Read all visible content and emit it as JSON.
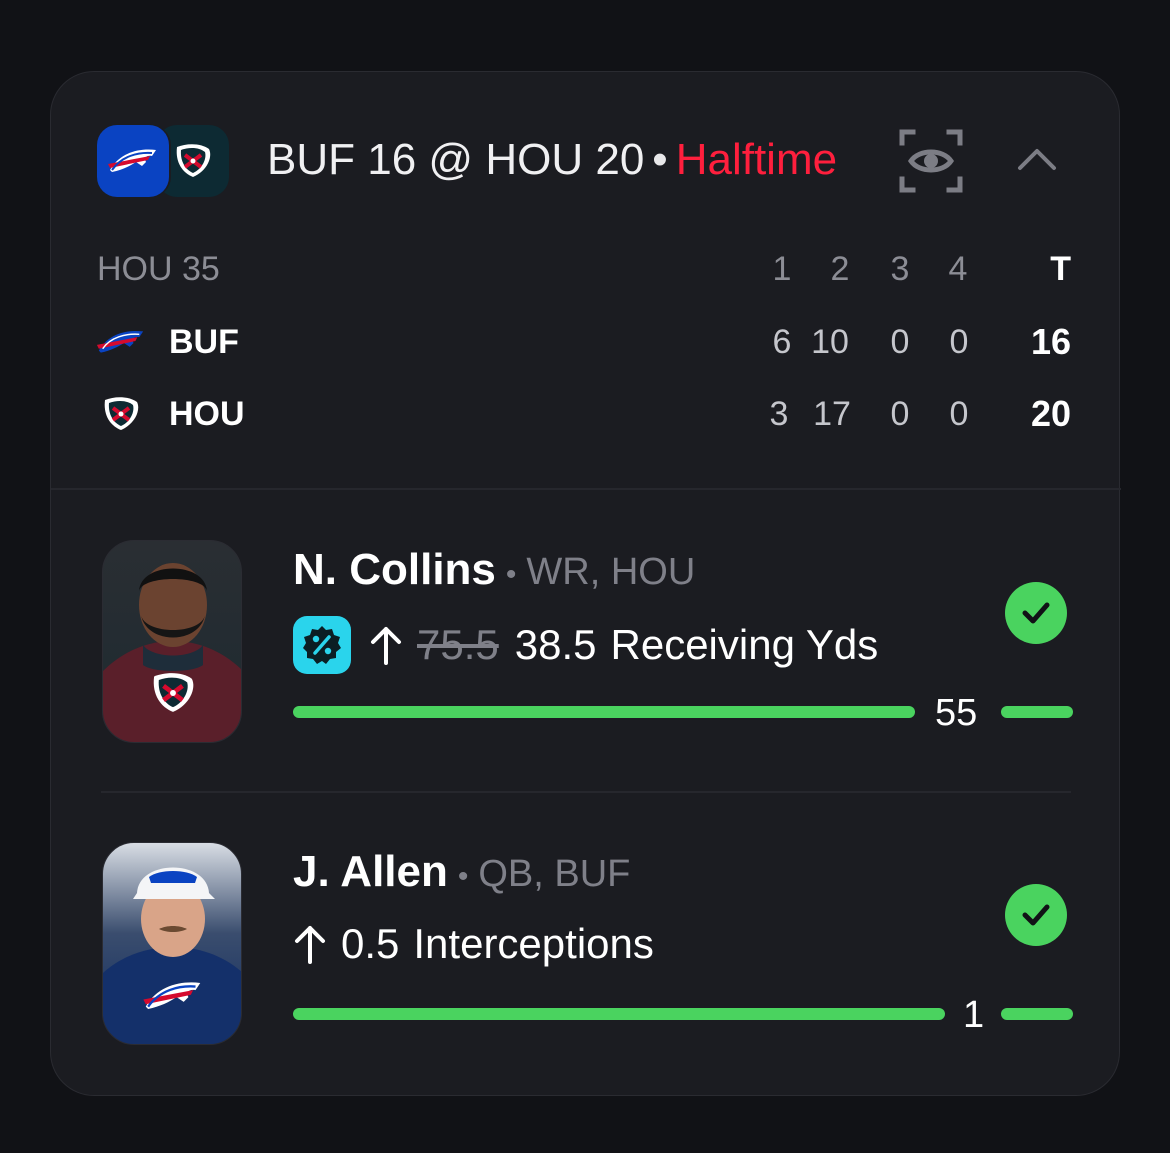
{
  "header": {
    "away_abbr": "BUF",
    "away_score": "16",
    "at": "@",
    "home_abbr": "HOU",
    "home_score": "20",
    "separator": "•",
    "status": "Halftime",
    "icons": [
      "bills-logo",
      "texans-logo",
      "eye-scan-icon",
      "chevron-up-icon"
    ],
    "status_color": "#ff1f3d"
  },
  "scoreboard": {
    "possession": "HOU 35",
    "quarter_headers": [
      "1",
      "2",
      "3",
      "4"
    ],
    "total_header": "T",
    "teams": [
      {
        "abbr": "BUF",
        "quarters": [
          "6",
          "10",
          "0",
          "0"
        ],
        "total": "16",
        "logo": "bills-logo"
      },
      {
        "abbr": "HOU",
        "quarters": [
          "3",
          "17",
          "0",
          "0"
        ],
        "total": "20",
        "logo": "texans-logo"
      }
    ]
  },
  "props": [
    {
      "player": "N. Collins",
      "separator": "•",
      "position_team": "WR, HOU",
      "boost_icon": "percent-boost-icon",
      "direction_icon": "arrow-up-icon",
      "old_line": "75.5",
      "line": "38.5",
      "stat": "Receiving Yds",
      "current_value": "55",
      "progress": 1.0,
      "status_icon": "check-icon",
      "team_logo": "texans-logo"
    },
    {
      "player": "J. Allen",
      "separator": "•",
      "position_team": "QB, BUF",
      "direction_icon": "arrow-up-icon",
      "line": "0.5",
      "stat": "Interceptions",
      "current_value": "1",
      "progress": 1.0,
      "status_icon": "check-icon",
      "team_logo": "bills-logo"
    }
  ],
  "colors": {
    "background": "#111216",
    "card": "#1b1c21",
    "success_green": "#4ad35f",
    "boost_cyan": "#2ad4ec",
    "bills_blue": "#0a43c2",
    "texans_navy": "#0d2a33"
  }
}
